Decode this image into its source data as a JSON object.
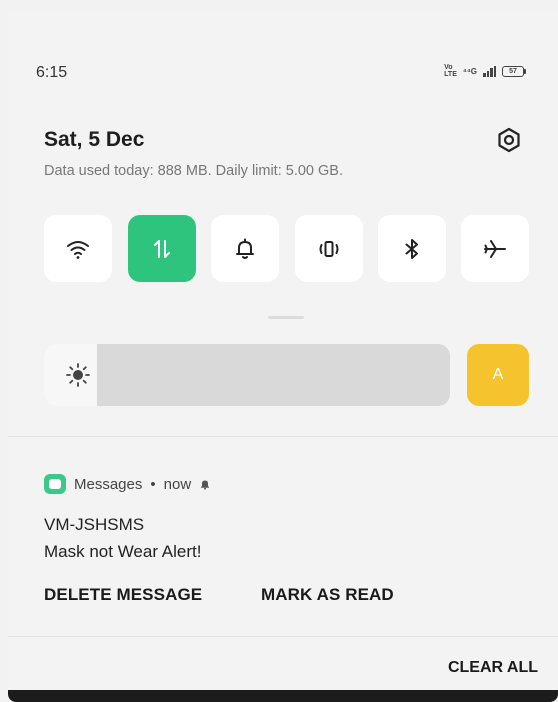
{
  "status_bar": {
    "time": "6:15",
    "volte_top": "Vo",
    "volte_bottom": "LTE",
    "network": "⁴⁴G",
    "battery": "57"
  },
  "header": {
    "date": "Sat, 5 Dec",
    "data_usage": "Data used today: 888 MB. Daily limit: 5.00 GB."
  },
  "quick_settings": {
    "tiles": [
      {
        "icon": "wifi-icon",
        "active": false
      },
      {
        "icon": "mobile-data-icon",
        "active": true
      },
      {
        "icon": "bell-icon",
        "active": false
      },
      {
        "icon": "vibrate-icon",
        "active": false
      },
      {
        "icon": "bluetooth-icon",
        "active": false
      },
      {
        "icon": "airplane-icon",
        "active": false
      }
    ],
    "brightness_level": 0.13,
    "auto_brightness_label": "A",
    "active_color": "#2fc47d",
    "auto_color": "#f5c32d"
  },
  "notification": {
    "app_name": "Messages",
    "separator": "•",
    "time": "now",
    "title": "VM-JSHSMS",
    "text": "Mask not Wear Alert!",
    "actions": [
      "DELETE MESSAGE",
      "MARK AS READ"
    ]
  },
  "footer": {
    "clear_all_label": "CLEAR ALL"
  }
}
